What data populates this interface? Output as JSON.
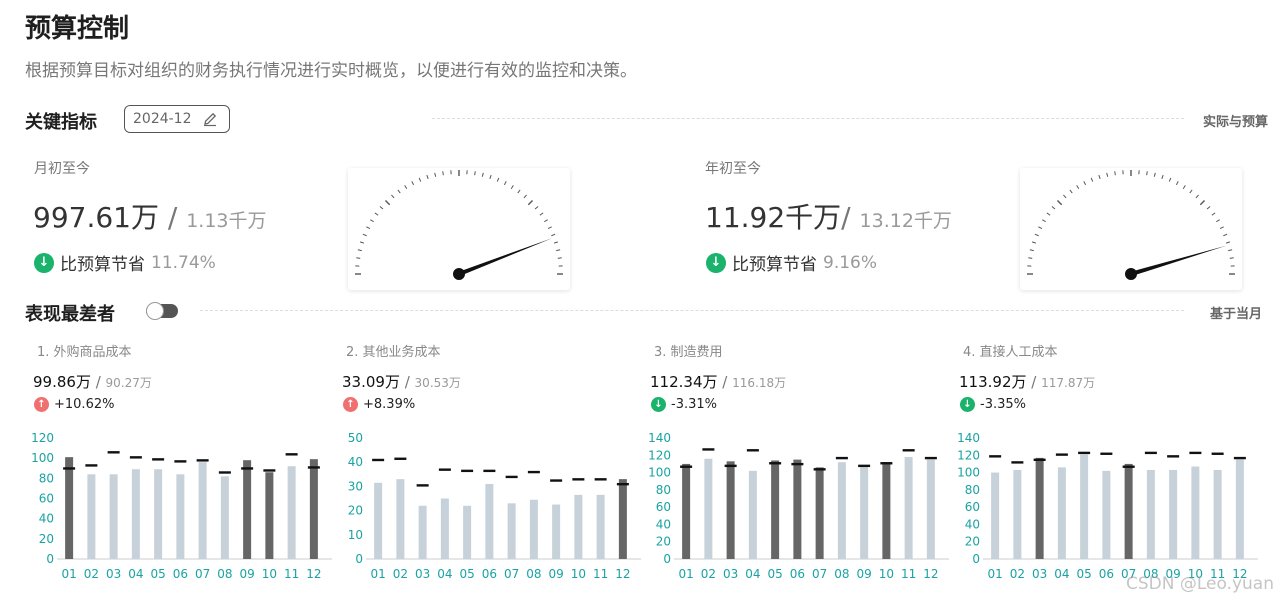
{
  "page": {
    "title": "预算控制",
    "subtitle": "根据预算目标对组织的财务执行情况进行实时概览，以便进行有效的监控和决策。"
  },
  "key_metrics": {
    "section_title": "关键指标",
    "date": "2024-12",
    "right_label": "实际与预算",
    "mtd": {
      "label": "月初至今",
      "actual": "997.61万",
      "separator": " / ",
      "budget": "1.13千万",
      "saving_label": "比预算节省",
      "saving_pct": "11.74%",
      "gauge_ratio": 0.883
    },
    "ytd": {
      "label": "年初至今",
      "actual": "11.92千万",
      "separator": "/ ",
      "budget": "13.12千万",
      "saving_label": "比预算节省",
      "saving_pct": "9.16%",
      "gauge_ratio": 0.908
    }
  },
  "worst": {
    "section_title": "表现最差者",
    "right_label": "基于当月",
    "toggle_on": true
  },
  "colors": {
    "bar_actual": "#666666",
    "bar_light": "#c7d1d9",
    "axis_text": "#1aa3a3",
    "green": "#19b36b",
    "red": "#f07070"
  },
  "cards": [
    {
      "rank": "1.",
      "name": "外购商品成本",
      "actual": "99.86万",
      "sep": " / ",
      "budget": "90.27万",
      "direction": "up",
      "change": "+10.62%",
      "chart_data": {
        "type": "bar",
        "categories": [
          "01",
          "02",
          "03",
          "04",
          "05",
          "06",
          "07",
          "08",
          "09",
          "10",
          "11",
          "12"
        ],
        "series": [
          {
            "values": [
              101,
              84,
              84,
              89,
              89,
              84,
              96,
              82,
              98,
              86,
              92,
              99
            ]
          },
          {
            "values": [
              90,
              93,
              106,
              101,
              99,
              97,
              98,
              86,
              90,
              88,
              104,
              91
            ]
          }
        ],
        "highlight": [
          true,
          false,
          false,
          false,
          false,
          false,
          false,
          false,
          true,
          true,
          false,
          true
        ],
        "yticks": [
          0,
          20,
          40,
          60,
          80,
          100,
          120
        ],
        "ylim": [
          0,
          120
        ]
      }
    },
    {
      "rank": "2.",
      "name": "其他业务成本",
      "actual": "33.09万",
      "sep": " / ",
      "budget": "30.53万",
      "direction": "up",
      "change": "+8.39%",
      "chart_data": {
        "type": "bar",
        "categories": [
          "01",
          "02",
          "03",
          "04",
          "05",
          "06",
          "07",
          "08",
          "09",
          "10",
          "11",
          "12"
        ],
        "series": [
          {
            "values": [
              31.5,
              33,
              22,
              25,
              22,
              31,
              23,
              24.5,
              22.5,
              26.5,
              26.5,
              33
            ]
          },
          {
            "values": [
              41,
              41.5,
              30.5,
              37,
              36.5,
              36.5,
              34,
              36,
              32.5,
              33,
              33,
              31
            ]
          }
        ],
        "highlight": [
          false,
          false,
          false,
          false,
          false,
          false,
          false,
          false,
          false,
          false,
          false,
          true
        ],
        "yticks": [
          0,
          10,
          20,
          30,
          40,
          50
        ],
        "ylim": [
          0,
          50
        ]
      }
    },
    {
      "rank": "3.",
      "name": "制造费用",
      "actual": "112.34万",
      "sep": " / ",
      "budget": "116.18万",
      "direction": "down",
      "change": "-3.31%",
      "chart_data": {
        "type": "bar",
        "categories": [
          "01",
          "02",
          "03",
          "04",
          "05",
          "06",
          "07",
          "08",
          "09",
          "10",
          "11",
          "12"
        ],
        "series": [
          {
            "values": [
              110,
              116,
              113,
              102,
              114,
              115,
              106,
              112,
              107,
              112,
              118,
              115
            ]
          },
          {
            "values": [
              107,
              127,
              108,
              126,
              111,
              110,
              104,
              117,
              108,
              111,
              126,
              117
            ]
          }
        ],
        "highlight": [
          true,
          false,
          true,
          false,
          true,
          true,
          true,
          false,
          false,
          true,
          false,
          false
        ],
        "yticks": [
          0,
          20,
          40,
          60,
          80,
          100,
          120,
          140
        ],
        "ylim": [
          0,
          140
        ]
      }
    },
    {
      "rank": "4.",
      "name": "直接人工成本",
      "actual": "113.92万",
      "sep": " / ",
      "budget": "117.87万",
      "direction": "down",
      "change": "-3.35%",
      "chart_data": {
        "type": "bar",
        "categories": [
          "01",
          "02",
          "03",
          "04",
          "05",
          "06",
          "07",
          "08",
          "09",
          "10",
          "11",
          "12"
        ],
        "series": [
          {
            "values": [
              100,
              103,
              117,
              106,
              121,
              102,
              110,
              103,
              103,
              107,
              103,
              115
            ]
          },
          {
            "values": [
              119,
              112,
              115,
              121,
              123,
              122,
              107,
              123,
              119,
              123,
              122,
              117
            ]
          }
        ],
        "highlight": [
          false,
          false,
          true,
          false,
          false,
          false,
          true,
          false,
          false,
          false,
          false,
          false
        ],
        "yticks": [
          0,
          20,
          40,
          60,
          80,
          100,
          120,
          140
        ],
        "ylim": [
          0,
          140
        ]
      }
    }
  ],
  "watermark": "CSDN @Leo.yuan"
}
